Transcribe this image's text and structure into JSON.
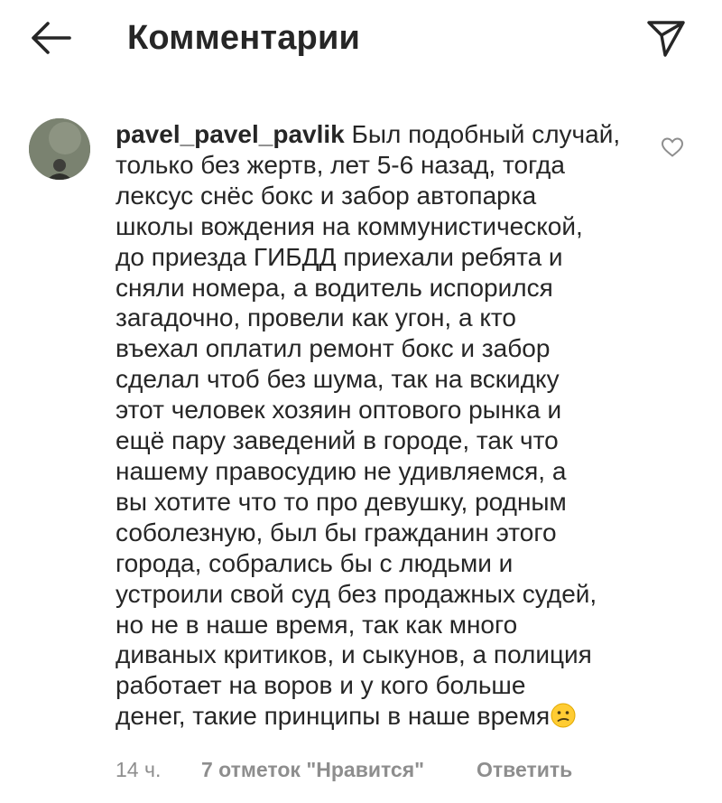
{
  "header": {
    "title": "Комментарии",
    "back_icon": "arrow-left-icon",
    "share_icon": "paper-plane-icon"
  },
  "comment": {
    "username": "pavel_pavel_pavlik",
    "text": " Был подобный случай,\nтолько без жертв, лет 5-6 назад, тогда\nлексус снёс бокс и забор автопарка\nшколы вождения на коммунистической,\nдо приезда ГИБДД приехали ребята и\nсняли номера, а водитель испорился\nзагадочно, провели как угон, а кто\nвъехал оплатил ремонт бокс и забор\nсделал чтоб без шума, так на вскидку\nэтот человек хозяин оптового рынка и\nещё пару заведений в городе, так что\nнашему правосудию не удивляемся, а\nвы хотите что то про девушку, родным\nсоболезную, был бы гражданин этого\nгорода, собрались бы с людьми и\nустроили свой суд без продажных судей,\nно не в наше время, так как много\nдиваных критиков, и сыкунов, а полиция\nработает на воров и у кого больше\nденег, такие принципы в наше время",
    "emoji_icon": "confused-face-emoji",
    "like_icon": "heart-outline-icon",
    "time": "14 ч.",
    "likes": "7 отметок \"Нравится\"",
    "reply": "Ответить"
  },
  "colors": {
    "text": "#262626",
    "secondary": "#8e8e8e",
    "emoji": "#ffcc33"
  }
}
